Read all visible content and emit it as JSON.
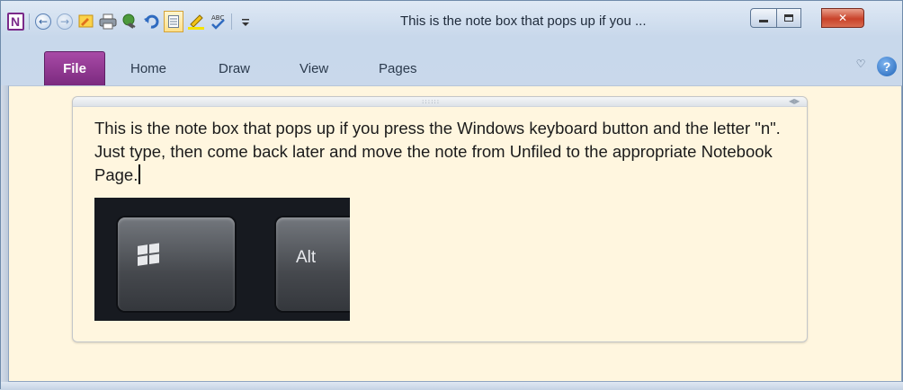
{
  "window": {
    "title": "This is the note box that pops up if you ...",
    "accent": "#7b2a7f"
  },
  "quick_access": {
    "app_icon_letter": "N",
    "items": [
      "back-icon",
      "forward-icon",
      "quick-note-icon",
      "print-icon",
      "link-icon",
      "undo-icon",
      "full-page-view-icon",
      "highlighter-icon",
      "spelling-icon",
      "customize-qat-icon"
    ]
  },
  "ribbon": {
    "tabs": [
      "File",
      "Home",
      "Draw",
      "View",
      "Pages"
    ]
  },
  "note": {
    "text": "This is the note box that pops up if you press the Windows keyboard button and the letter  \"n\".  Just type, then come back later and move the note from Unfiled to the appropriate Notebook Page.",
    "image_key_label": "Alt"
  },
  "colors": {
    "page_background": "#fff6df",
    "file_tab": "#7b2a7f",
    "close_button": "#c9422a"
  }
}
